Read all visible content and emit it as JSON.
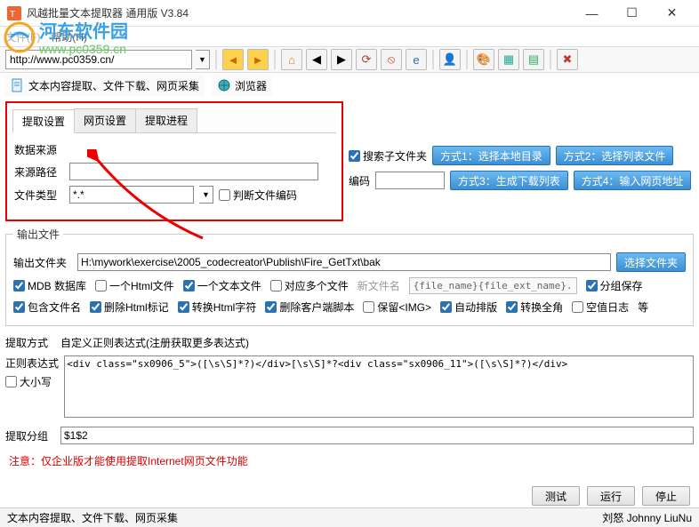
{
  "window": {
    "title": "风越批量文本提取器 通用版 V3.84",
    "min": "—",
    "max": "☐",
    "close": "✕"
  },
  "menubar": {
    "file": "文件(F)",
    "help": "帮助(H)"
  },
  "watermark": {
    "line1": "河东软件园",
    "line2": "www.pc0359.cn"
  },
  "addrbar": {
    "url": "http://www.pc0359.cn/"
  },
  "subtabs": {
    "main_label": "文本内容提取、文件下载、网页采集",
    "browser_label": "浏览器"
  },
  "tabs": {
    "t1": "提取设置",
    "t2": "网页设置",
    "t3": "提取进程"
  },
  "source": {
    "legend": "数据来源",
    "path_label": "来源路径",
    "type_label": "文件类型",
    "type_value": "*.*",
    "check_enc": "判断文件编码",
    "encoding_label": "编码",
    "search_sub": "搜索子文件夹",
    "btn1": "方式1：选择本地目录",
    "btn2": "方式2：选择列表文件",
    "btn3": "方式3：生成下载列表",
    "btn4": "方式4：输入网页地址"
  },
  "output": {
    "legend": "输出文件",
    "folder_label": "输出文件夹",
    "folder_value": "H:\\mywork\\exercise\\2005_codecreator\\Publish\\Fire_GetTxt\\bak",
    "choose_btn": "选择文件夹",
    "c_mdb": "MDB 数据库",
    "c_onehtml": "一个Html文件",
    "c_onetxt": "一个文本文件",
    "c_multi": "对应多个文件",
    "newfile_label": "新文件名",
    "newfile_value": "{file_name}{file_ext_name}.",
    "c_group": "分组保存",
    "c_incname": "包含文件名",
    "c_deltag": "删除Html标记",
    "c_conv": "转换Html字符",
    "c_delscript": "删除客户端脚本",
    "c_keepimg": "保留<IMG>",
    "c_autolayout": "自动排版",
    "c_convfull": "转换全角",
    "c_blankdate": "空值日志",
    "c_more": "等"
  },
  "extract": {
    "method_label": "提取方式",
    "method_value": "自定义正则表达式(注册获取更多表达式)",
    "regex_label": "正则表达式",
    "regex_value": "<div class=\"sx0906_5\">([\\s\\S]*?)</div>[\\s\\S]*?<div class=\"sx0906_11\">([\\s\\S]*?)</div>",
    "case_label": "大小写",
    "group_label": "提取分组",
    "group_value": "$1$2"
  },
  "note": "注意：仅企业版才能使用提取Internet网页文件功能",
  "buttons": {
    "test": "测试",
    "run": "运行",
    "stop": "停止"
  },
  "status": {
    "left": "文本内容提取、文件下载、网页采集",
    "right": "刘怒 Johnny LiuNu"
  }
}
